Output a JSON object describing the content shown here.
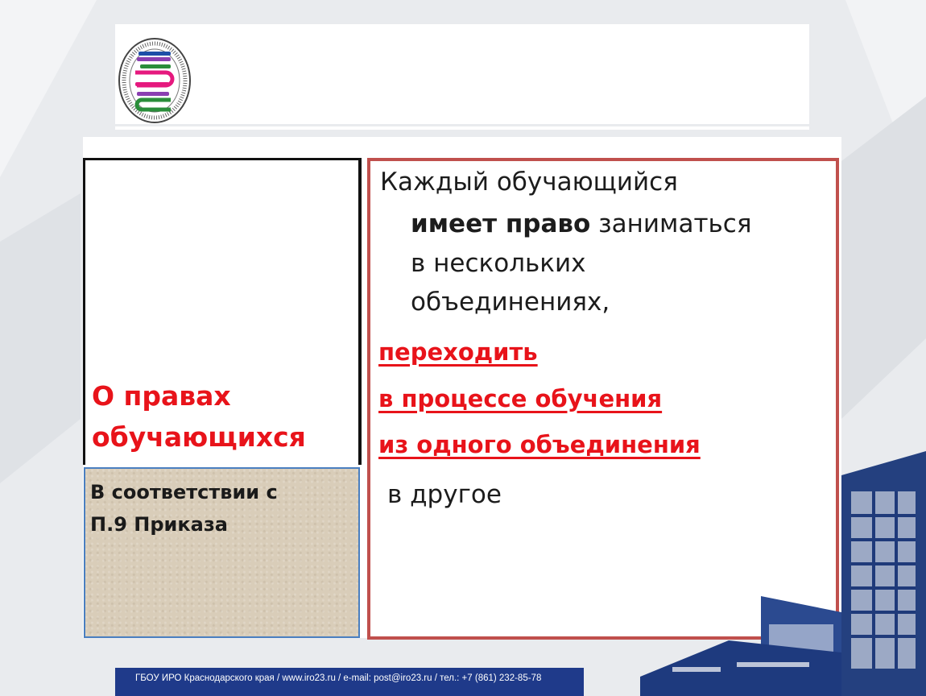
{
  "slide": {
    "title": "О правах обучающихся",
    "title_line1": "О правах",
    "title_line2": "обучающихся",
    "note_line1": "В соответствии с",
    "note_line2": "П.9 Приказа"
  },
  "main": {
    "line1": "Каждый обучающийся",
    "line2_bold": "имеет право",
    "line2_rest": " заниматься",
    "line3": "в нескольких",
    "line4": "объединениях,",
    "red1": "переходить",
    "red2": "в процессе обучения",
    "red3": "из одного объединения",
    "last": "в другое"
  },
  "footer": {
    "text": "ГБОУ ИРО Краснодарского края / www.iro23.ru / e-mail: post@iro23.ru / тел.: +7 (861) 232-85-78"
  },
  "logo": {
    "ring_text": "ИНСТИТУТ РАЗВИТИЯ ОБРАЗОВАНИЯ КРАСНОДАРСКОГО КРАЯ"
  },
  "colors": {
    "accent_red": "#e8131a",
    "border_red": "#c0504d",
    "footer_blue": "#1f3a8a",
    "note_beige": "#d9cdb9"
  }
}
